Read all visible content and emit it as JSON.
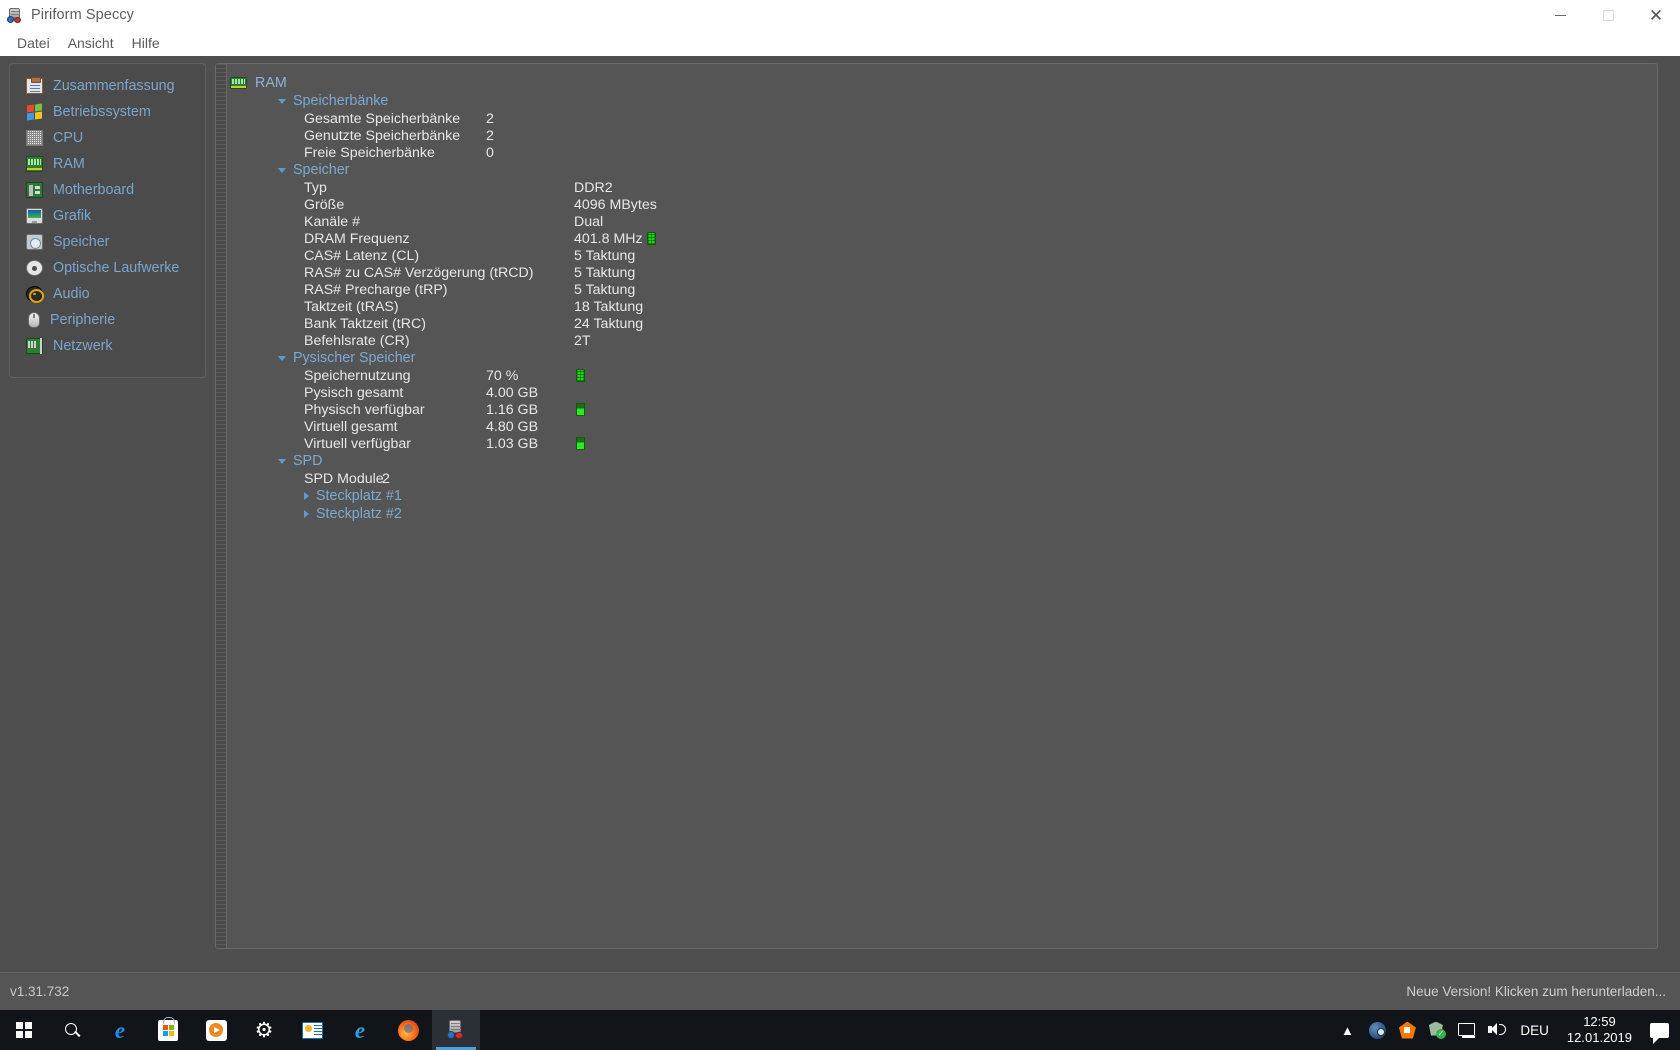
{
  "window": {
    "title": "Piriform Speccy",
    "icon": "speccy-icon",
    "controls": {
      "minimize": "minimize-button",
      "maximize": "maximize-button",
      "close": "close-button"
    }
  },
  "menubar": {
    "items": [
      "Datei",
      "Ansicht",
      "Hilfe"
    ]
  },
  "sidebar": {
    "items": [
      {
        "label": "Zusammenfassung",
        "icon": "clipboard-icon"
      },
      {
        "label": "Betriebssystem",
        "icon": "windows-flag-icon"
      },
      {
        "label": "CPU",
        "icon": "cpu-chip-icon"
      },
      {
        "label": "RAM",
        "icon": "memory-module-icon"
      },
      {
        "label": "Motherboard",
        "icon": "motherboard-icon"
      },
      {
        "label": "Grafik",
        "icon": "monitor-icon"
      },
      {
        "label": "Speicher",
        "icon": "harddisk-icon"
      },
      {
        "label": "Optische Laufwerke",
        "icon": "optical-disc-icon"
      },
      {
        "label": "Audio",
        "icon": "speaker-icon"
      },
      {
        "label": "Peripherie",
        "icon": "mouse-icon"
      },
      {
        "label": "Netzwerk",
        "icon": "network-card-icon"
      }
    ]
  },
  "content": {
    "root": {
      "label": "RAM",
      "icon": "memory-module-icon"
    },
    "groups": [
      {
        "label": "Speicherbänke",
        "expanded": true,
        "rows": [
          {
            "key": "Gesamte Speicherbänke",
            "value": "2"
          },
          {
            "key": "Genutzte Speicherbänke",
            "value": "2"
          },
          {
            "key": "Freie Speicherbänke",
            "value": "0"
          }
        ]
      },
      {
        "label": "Speicher",
        "expanded": true,
        "rows": [
          {
            "key": "Typ",
            "value": "DDR2"
          },
          {
            "key": "Größe",
            "value": "4096 MBytes"
          },
          {
            "key": "Kanäle #",
            "value": "Dual"
          },
          {
            "key": "DRAM Frequenz",
            "value": "401.8 MHz",
            "led": "full"
          },
          {
            "key": "CAS# Latenz (CL)",
            "value": "5 Taktung"
          },
          {
            "key": "RAS# zu CAS# Verzögerung (tRCD)",
            "value": "5 Taktung"
          },
          {
            "key": "RAS# Precharge (tRP)",
            "value": "5 Taktung"
          },
          {
            "key": "Taktzeit (tRAS)",
            "value": "18 Taktung"
          },
          {
            "key": "Bank Taktzeit (tRC)",
            "value": "24 Taktung"
          },
          {
            "key": "Befehlsrate (CR)",
            "value": "2T"
          }
        ]
      },
      {
        "label": "Pysischer Speicher",
        "expanded": true,
        "rows": [
          {
            "key": "Speichernutzung",
            "value": "70 %",
            "led": "full"
          },
          {
            "key": "Pysisch gesamt",
            "value": "4.00 GB"
          },
          {
            "key": "Physisch verfügbar",
            "value": "1.16 GB",
            "led": "half"
          },
          {
            "key": "Virtuell gesamt",
            "value": "4.80 GB"
          },
          {
            "key": "Virtuell verfügbar",
            "value": "1.03 GB",
            "led": "half"
          }
        ]
      },
      {
        "label": "SPD",
        "expanded": true,
        "rows": [
          {
            "key": "SPD Module",
            "value": "2"
          }
        ],
        "subgroups": [
          {
            "label": "Steckplatz #1",
            "expanded": false
          },
          {
            "label": "Steckplatz #2",
            "expanded": false
          }
        ]
      }
    ]
  },
  "statusbar": {
    "version": "v1.31.732",
    "update_notice": "Neue Version! Klicken zum herunterladen..."
  },
  "taskbar": {
    "items": [
      {
        "name": "start-button",
        "icon": "windows-logo-icon"
      },
      {
        "name": "search-button",
        "icon": "search-icon"
      },
      {
        "name": "edge-button",
        "icon": "edge-icon"
      },
      {
        "name": "store-button",
        "icon": "microsoft-store-icon"
      },
      {
        "name": "media-player-button",
        "icon": "media-player-icon"
      },
      {
        "name": "settings-button",
        "icon": "gear-icon"
      },
      {
        "name": "news-button",
        "icon": "news-icon"
      },
      {
        "name": "internet-explorer-button",
        "icon": "internet-explorer-icon"
      },
      {
        "name": "firefox-button",
        "icon": "firefox-icon"
      },
      {
        "name": "speccy-taskbar-button",
        "icon": "speccy-icon"
      }
    ],
    "tray": {
      "expand": "chevron-up-icon",
      "icons": [
        "steam-icon",
        "avast-icon",
        "shield-check-icon",
        "network-monitor-icon",
        "volume-icon"
      ],
      "language": "DEU",
      "time": "12:59",
      "date": "12.01.2019",
      "action_center": "action-center-icon"
    }
  },
  "colors": {
    "window_chrome": "#ffffff",
    "app_background": "#4f4f4f",
    "panel_background": "#555555",
    "accent_link": "#79a6cf",
    "text_primary": "#e7e7e7",
    "led_green": "#23d119",
    "taskbar": "#111418"
  }
}
